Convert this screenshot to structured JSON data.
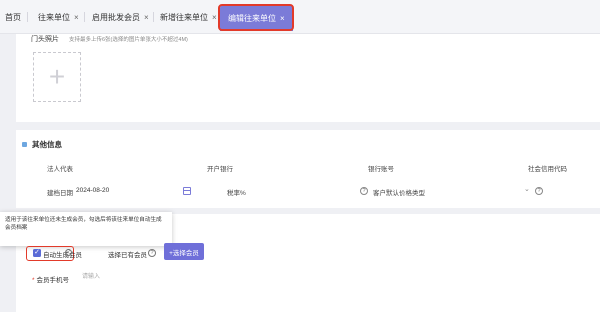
{
  "tabs": [
    {
      "label": "首页",
      "closable": false
    },
    {
      "label": "往来单位",
      "closable": true
    },
    {
      "label": "启用批发会员",
      "closable": true
    },
    {
      "label": "新增往来单位",
      "closable": true
    },
    {
      "label": "编辑往来单位",
      "closable": true,
      "active": true
    }
  ],
  "close_glyph": "×",
  "photo": {
    "label": "门头照片",
    "hint": "支持最多上传6张(选择的图片单张大小不超过4M)",
    "plus": "+"
  },
  "other_info": {
    "title": "其他信息",
    "columns": [
      "法人代表",
      "开户银行",
      "银行账号",
      "社会信用代码"
    ],
    "build_date_label": "建档日期",
    "build_date_value": "2024-08-20",
    "tax_rate_label": "税率%",
    "default_price_type_label": "客户默认价格类型"
  },
  "tooltip_text": "适用于该往来单位还未生成会员，勾选后将该往来单位自动生成会员档案",
  "auto_member": {
    "label": "自动生成会员",
    "checked_glyph": "✓",
    "select_existing_label": "选择已有会员",
    "select_button": "+选择会员"
  },
  "member_phone": {
    "required_mark": "*",
    "label": "会员手机号",
    "placeholder": "请输入"
  },
  "colors": {
    "accent": "#6f6fd9",
    "tab_active": "#7b7bd8",
    "highlight": "#e23a2a"
  }
}
